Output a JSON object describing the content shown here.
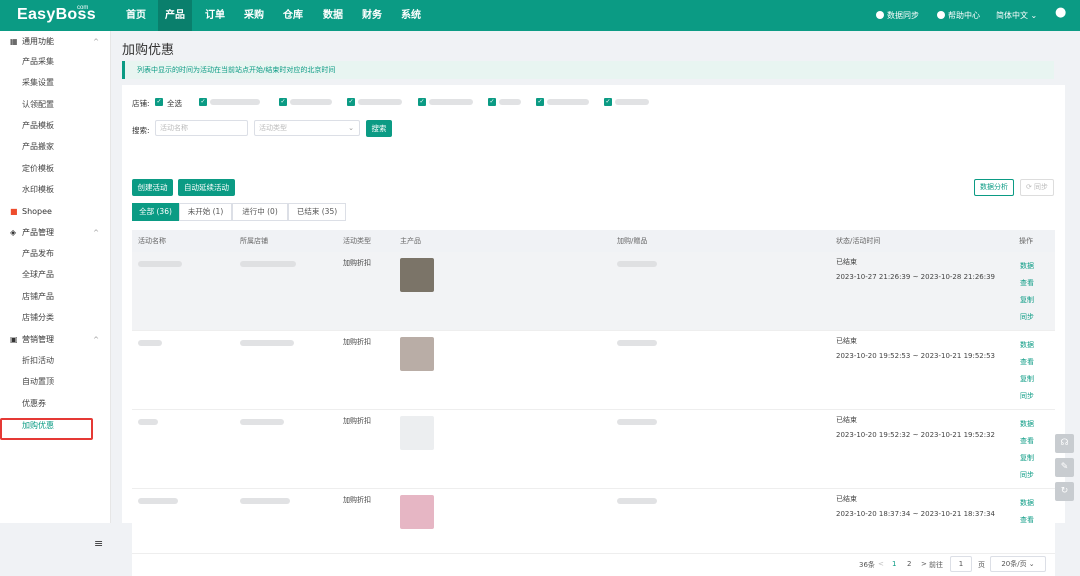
{
  "app": {
    "logo": "EasyBoss",
    "logo_sup": "com"
  },
  "nav": [
    "首页",
    "产品",
    "订单",
    "采购",
    "仓库",
    "数据",
    "财务",
    "系统"
  ],
  "header_right": {
    "sync": "数据同步",
    "help": "帮助中心",
    "lang": "简体中文"
  },
  "sidebar": {
    "group1": {
      "label": "通用功能",
      "items": [
        "产品采集",
        "采集设置",
        "认领配置",
        "产品模板",
        "产品搬家",
        "定价模板",
        "水印模板"
      ]
    },
    "platform": "Shopee",
    "group2": {
      "label": "产品管理",
      "items": [
        "产品发布",
        "全球产品",
        "店铺产品",
        "店铺分类"
      ]
    },
    "group3": {
      "label": "营销管理",
      "items": [
        "折扣活动",
        "自动置顶",
        "优惠券",
        "加购优惠"
      ]
    }
  },
  "page": {
    "title": "加购优惠",
    "notice": "列表中显示的时间为活动在当前站点开始/结束时对应的北京时间"
  },
  "filters": {
    "store_label": "店铺:",
    "select_all": "全选",
    "search_label": "搜索:",
    "name_placeholder": "活动名称",
    "type_placeholder": "活动类型",
    "search_btn": "搜索"
  },
  "actions": {
    "create": "创建活动",
    "auto_extend": "自动延续活动",
    "analysis": "数据分析",
    "sync": "同步"
  },
  "tabs": [
    "全部 (36)",
    "未开始 (1)",
    "进行中 (0)",
    "已结束 (35)"
  ],
  "table": {
    "headers": [
      "活动名称",
      "所属店铺",
      "活动类型",
      "主产品",
      "加购/赠品",
      "状态/活动时间",
      "操作"
    ],
    "rows": [
      {
        "type": "加购折扣",
        "status": "已结束",
        "time": "2023-10-27 21:26:39 ~ 2023-10-28 21:26:39",
        "ops": [
          "数据",
          "查看",
          "复制",
          "同步"
        ]
      },
      {
        "type": "加购折扣",
        "status": "已结束",
        "time": "2023-10-20 19:52:53 ~ 2023-10-21 19:52:53",
        "ops": [
          "数据",
          "查看",
          "复制",
          "同步"
        ]
      },
      {
        "type": "加购折扣",
        "status": "已结束",
        "time": "2023-10-20 19:52:32 ~ 2023-10-21 19:52:32",
        "ops": [
          "数据",
          "查看",
          "复制",
          "同步"
        ]
      },
      {
        "type": "加购折扣",
        "status": "已结束",
        "time": "2023-10-20 18:37:34 ~ 2023-10-21 18:37:34",
        "ops": [
          "数据",
          "查看"
        ]
      }
    ]
  },
  "pager": {
    "total": "36条",
    "prev": "<",
    "p1": "1",
    "p2": "2",
    "next": ">",
    "goto": "前往",
    "page": "1",
    "page_unit": "页",
    "size": "20条/页"
  },
  "colors": {
    "primary": "#0b9b84",
    "highlight_box": "#e53935"
  }
}
